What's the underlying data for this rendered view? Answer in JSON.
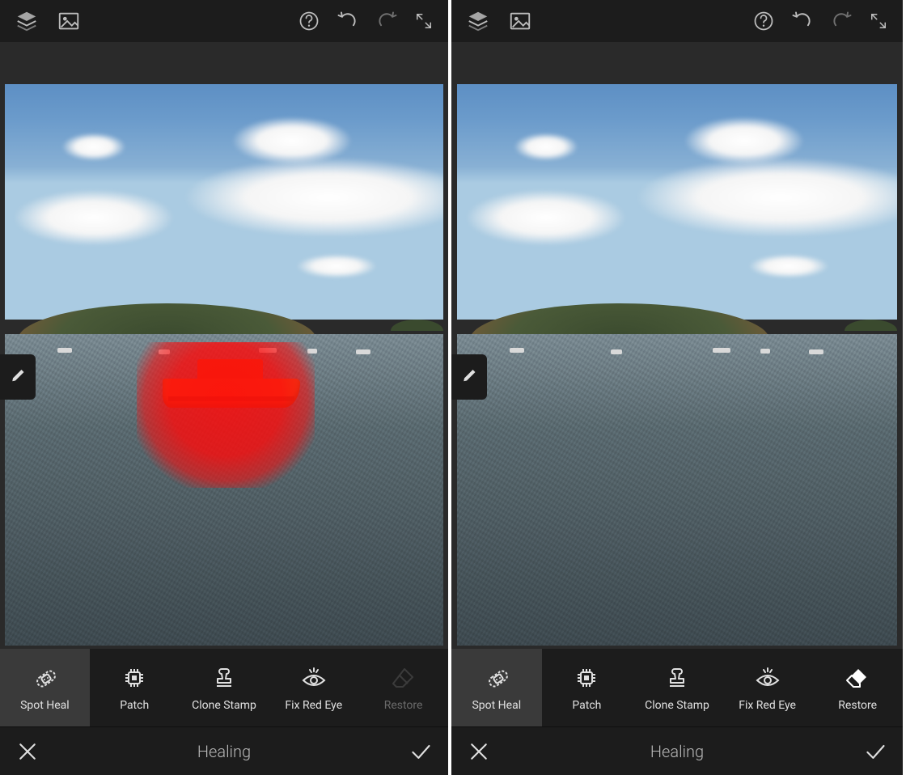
{
  "mode_title": "Healing",
  "icons": {
    "layers": "layers-icon",
    "image": "image-icon",
    "help": "help-icon",
    "undo": "undo-icon",
    "redo": "redo-icon",
    "expand": "expand-icon",
    "brush": "brush-icon",
    "close": "close-icon",
    "confirm": "checkmark-icon"
  },
  "tools": [
    {
      "id": "spot-heal",
      "label": "Spot Heal",
      "icon": "bandage-icon"
    },
    {
      "id": "patch",
      "label": "Patch",
      "icon": "chip-icon"
    },
    {
      "id": "clone-stamp",
      "label": "Clone Stamp",
      "icon": "stamp-icon"
    },
    {
      "id": "fix-red-eye",
      "label": "Fix Red Eye",
      "icon": "redeye-icon"
    },
    {
      "id": "restore",
      "label": "Restore",
      "icon": "eraser-icon"
    }
  ],
  "panels": {
    "left": {
      "selected_tool": "spot-heal",
      "restore_enabled": false,
      "heal_mask_visible": true,
      "boat_visible": true
    },
    "right": {
      "selected_tool": "spot-heal",
      "restore_enabled": true,
      "heal_mask_visible": false,
      "boat_visible": false
    }
  },
  "colors": {
    "heal_mask": "#ff0a0a",
    "accent_bg_selected": "#3a3a3a",
    "topbar_bg": "#1c1c1c",
    "canvas_bg": "#2a2a2a"
  }
}
